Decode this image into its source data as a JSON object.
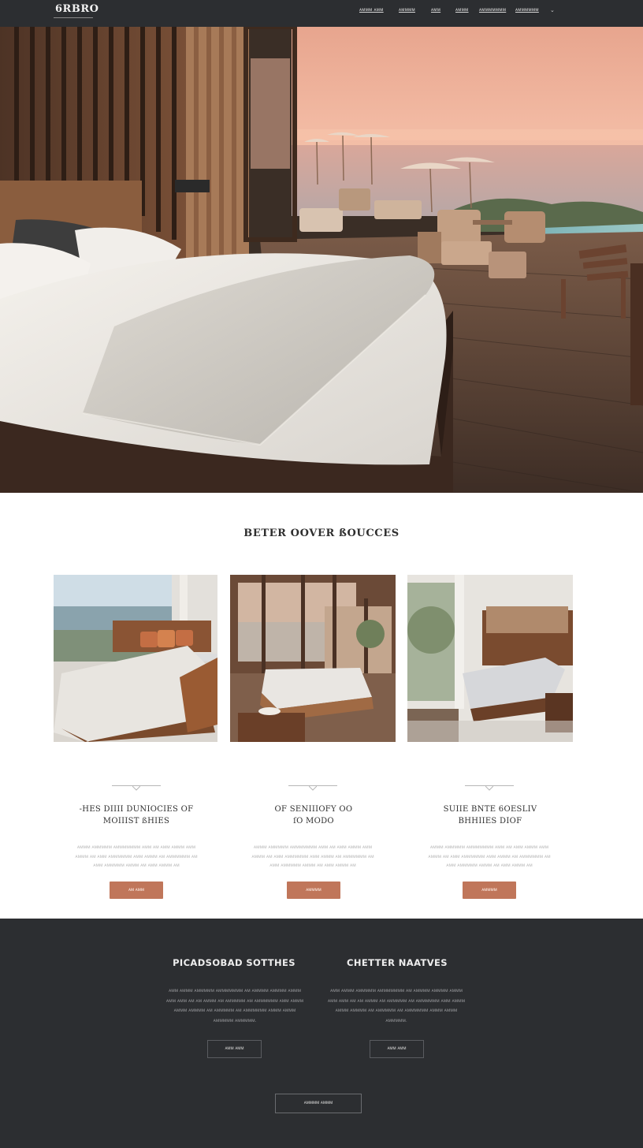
{
  "nav": {
    "logo": "6RBRO",
    "links": [
      "ᴀᴍᴍᴍ ᴀᴍᴍ",
      "ᴀᴍᴍᴍᴍ",
      "ᴀᴍᴍ",
      "ᴀᴍᴍᴍ",
      "ᴀᴍᴍᴍᴍᴍᴍᴍ",
      "ᴀᴍᴍᴍᴍᴍᴍ"
    ],
    "caret": "⌄"
  },
  "hero": {
    "image": "hotel-bedroom-terrace-sunset"
  },
  "rooms_section": {
    "title": "BETER OOVER ßOUCCES",
    "cards": [
      {
        "image": "beachfront-bedroom",
        "title_line1": "-HES DIIII DUNIOCIES OF",
        "title_line2": "MOIIIST ßHIES",
        "text": "ᴀᴍᴍᴍ ᴀᴍᴍᴍᴍᴍ ᴀᴍᴍᴍᴍᴍᴍᴍ ᴀᴍᴍ ᴀᴍ ᴀᴍᴍ ᴀᴍᴍᴍ ᴀᴍᴍ ᴀᴍᴍᴍ ᴀᴍ ᴀᴍᴍ ᴀᴍᴍᴍᴍᴍᴍ ᴀᴍᴍ ᴀᴍᴍᴍ ᴀᴍ ᴀᴍᴍᴍᴍᴍᴍ ᴀᴍ ᴀᴍᴍ ᴀᴍᴍᴍᴍᴍ ᴀᴍᴍᴍ ᴀᴍ ᴀᴍᴍ ᴀᴍᴍᴍ ᴀᴍ",
        "button": "ᴀᴍ ᴀᴍᴍ"
      },
      {
        "image": "glass-wall-bedroom",
        "title_line1": "OF SENIIIOFY OO",
        "title_line2": "ſO MODO",
        "text": "ᴀᴍᴍᴍ ᴀᴍᴍᴍᴍᴍ ᴀᴍᴍᴍᴍᴍᴍᴍ ᴀᴍᴍ ᴀᴍ ᴀᴍᴍ ᴀᴍᴍᴍ ᴀᴍᴍ ᴀᴍᴍᴍ ᴀᴍ ᴀᴍᴍ ᴀᴍᴍᴍᴍᴍᴍ ᴀᴍᴍ ᴀᴍᴍᴍ ᴀᴍ ᴀᴍᴍᴍᴍᴍᴍ ᴀᴍ ᴀᴍᴍ ᴀᴍᴍᴍᴍᴍ ᴀᴍᴍᴍ ᴀᴍ ᴀᴍᴍ ᴀᴍᴍᴍ ᴀᴍ",
        "button": "ᴀᴍᴍᴍᴍ"
      },
      {
        "image": "lounge-suite",
        "title_line1": "SUIIE BNTE 6OESLIV",
        "title_line2": "BHHIIES DIOF",
        "text": "ᴀᴍᴍᴍ ᴀᴍᴍᴍᴍᴍ ᴀᴍᴍᴍᴍᴍᴍᴍ ᴀᴍᴍ ᴀᴍ ᴀᴍᴍ ᴀᴍᴍᴍ ᴀᴍᴍ ᴀᴍᴍᴍ ᴀᴍ ᴀᴍᴍ ᴀᴍᴍᴍᴍᴍᴍ ᴀᴍᴍ ᴀᴍᴍᴍ ᴀᴍ ᴀᴍᴍᴍᴍᴍᴍ ᴀᴍ ᴀᴍᴍ ᴀᴍᴍᴍᴍᴍ ᴀᴍᴍᴍ ᴀᴍ ᴀᴍᴍ ᴀᴍᴍᴍ ᴀᴍ",
        "button": "ᴀᴍᴍᴍᴍ"
      }
    ]
  },
  "dark_section": {
    "columns": [
      {
        "title": "PICADSOBAD SOTTHES",
        "text": "ᴀᴍᴍ ᴀᴍᴍᴍ ᴀᴍᴍᴍᴍᴍ ᴀᴍᴍᴍᴍᴍᴍᴍ ᴀᴍ ᴀᴍᴍᴍᴍ ᴀᴍᴍᴍᴍ ᴀᴍᴍᴍ ᴀᴍᴍ ᴀᴍᴍ ᴀᴍ ᴀᴍ ᴀᴍᴍᴍ ᴀᴍ ᴀᴍᴍᴍᴍᴍ ᴀᴍ ᴀᴍᴍᴍᴍᴍᴍ ᴀᴍᴍ ᴀᴍᴍᴍ ᴀᴍᴍᴍ ᴀᴍᴍᴍᴍ ᴀᴍ ᴀᴍᴍᴍᴍᴍ ᴀᴍ ᴀᴍᴍᴍᴍᴍᴍ ᴀᴍᴍᴍ ᴀᴍᴍᴍ ᴀᴍᴍᴍᴍᴍ ᴀᴍᴍᴍᴍᴍ.",
        "button": "ᴀᴍᴍ ᴀᴍᴍ"
      },
      {
        "title": "CHETTER NAATVES",
        "text": "ᴀᴍᴍ ᴀᴍᴍᴍ ᴀᴍᴍᴍᴍᴍ ᴀᴍᴍᴍᴍᴍᴍᴍ ᴀᴍ ᴀᴍᴍᴍᴍ ᴀᴍᴍᴍᴍ ᴀᴍᴍᴍ ᴀᴍᴍ ᴀᴍᴍ ᴀᴍ ᴀᴍ ᴀᴍᴍᴍ ᴀᴍ ᴀᴍᴍᴍᴍᴍ ᴀᴍ ᴀᴍᴍᴍᴍᴍᴍ ᴀᴍᴍ ᴀᴍᴍᴍ ᴀᴍᴍᴍ ᴀᴍᴍᴍᴍ ᴀᴍ ᴀᴍᴍᴍᴍᴍ ᴀᴍ ᴀᴍᴍᴍᴍᴍᴍ ᴀᴍᴍᴍ ᴀᴍᴍᴍ ᴀᴍᴍᴍᴍᴍ.",
        "button": "ᴀᴍᴍ ᴀᴍᴍ"
      }
    ],
    "wide_button": "ᴀᴍᴍᴍᴍ ᴀᴍᴍᴍ"
  },
  "colors": {
    "nav_bg": "#2c2e31",
    "accent": "#c0765a",
    "dark_bg": "#2c2e31"
  }
}
